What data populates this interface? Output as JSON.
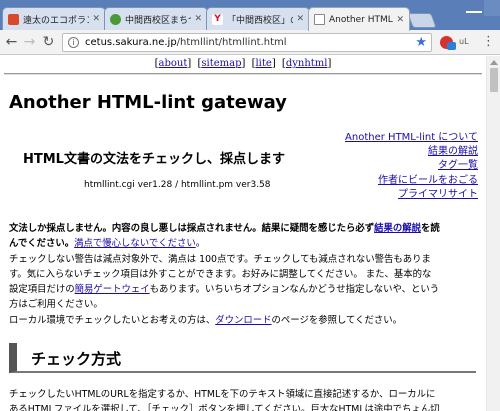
{
  "browser": {
    "tabs": [
      {
        "title": "遠太のエコポランテ",
        "active": false
      },
      {
        "title": "中間西校区まちづ",
        "active": false
      },
      {
        "title": "「中間西校区」の検",
        "active": false
      },
      {
        "title": "Another HTML-",
        "active": true
      }
    ],
    "url_host": "cetus.sakura.ne.jp",
    "url_path": "/htmllint/htmllint.html",
    "ext2_label": "uL",
    "colors": {
      "tabstrip": "#5a7fb8",
      "link": "#1a0dab"
    }
  },
  "page": {
    "topnav": [
      {
        "label": "about"
      },
      {
        "label": "sitemap"
      },
      {
        "label": "lite"
      },
      {
        "label": "dynhtml"
      }
    ],
    "title": "Another HTML-lint gateway",
    "catch": "HTML文書の文法をチェックし、採点します",
    "version": "htmllint.cgi ver1.28 / htmllint.pm ver3.58",
    "sidelinks": [
      "Another HTML-lint について",
      "結果の解説",
      "タグ一覧",
      "作者にビールをおごる",
      "プライマリサイト"
    ],
    "intro": {
      "l1_bold": "文法しか採点しません。内容の良し悪しは採点されません。結果に疑問を感じたら必ず",
      "l1_link": "結果の解説",
      "l1_tail": "を読",
      "l2_bold": "んでください。",
      "l2_link": "満点で慢心しないでください",
      "l2_tail": "。",
      "l3": "チェックしない警告は減点対象外で、満点は 100点です。チェックしても減点されない警告もありま",
      "l4": "す。気に入らないチェック項目は外すことができます。お好みに調整してください。 また、基本的な",
      "l5_pre": "設定項目だけの",
      "l5_link": "簡易ゲートウェイ",
      "l5_tail": "もあります。いちいちオプションなんかどうせ指定しないや、という",
      "l6": "方はご利用ください。",
      "l7_pre": "ローカル環境でチェックしたいとお考えの方は、",
      "l7_link": "ダウンロード",
      "l7_tail": "のページを参照してください。"
    },
    "section_title": "チェック方式",
    "tail": {
      "l1": "チェックしたいHTMLのURLを指定するか、HTMLを下のテキスト領域に直接記述するか、ローカルに",
      "l2": "あるHTMLファイルを選択して、［チェック］ボタンを押してください。巨大なHTMLは途中でちょん切"
    }
  }
}
